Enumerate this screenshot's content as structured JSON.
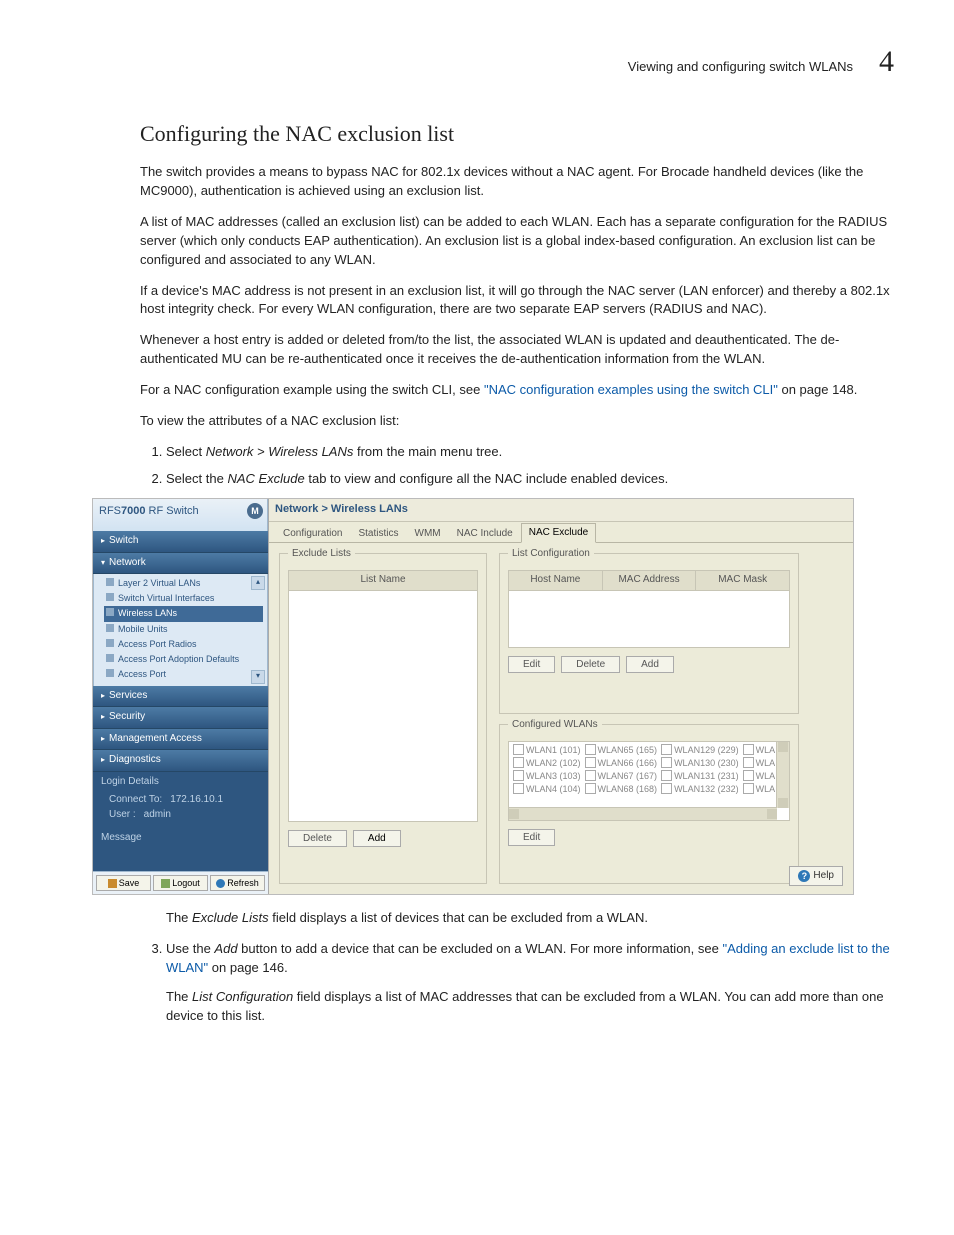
{
  "header": {
    "section_name": "Viewing and configuring switch WLANs",
    "chapter_number": "4"
  },
  "title": "Configuring the NAC exclusion list",
  "para1": "The switch provides a means to bypass NAC for 802.1x devices without a NAC agent. For Brocade handheld devices (like the MC9000), authentication is achieved using an exclusion list.",
  "para2": "A list of MAC addresses (called an exclusion list) can be added to each WLAN. Each has a separate configuration for the RADIUS server (which only conducts EAP authentication). An exclusion list is a global index-based configuration. An exclusion list can be configured and associated to any WLAN.",
  "para3": "If a device's MAC address is not present in an exclusion list, it will go through the NAC server (LAN enforcer) and thereby a 802.1x host integrity check. For every WLAN configuration, there are two separate EAP servers (RADIUS and NAC).",
  "para4": "Whenever a host entry is added or deleted from/to the list, the associated WLAN is updated and deauthenticated. The de-authenticated MU can be re-authenticated once it receives the de-authentication information from the WLAN.",
  "para5_pre": "For a NAC configuration example using the switch CLI, see ",
  "para5_link": "\"NAC configuration examples using the switch CLI\"",
  "para5_post": " on page 148.",
  "para6": "To view the attributes of a NAC exclusion list:",
  "step1_pre": "Select ",
  "step1_em": "Network > Wireless LANs",
  "step1_post": " from the main menu tree.",
  "step2_pre": "Select the ",
  "step2_em": "NAC Exclude",
  "step2_post": " tab to view and configure all the NAC include enabled devices.",
  "excl_para_pre": "The ",
  "excl_para_em": "Exclude Lists",
  "excl_para_post": " field displays a list of devices that can be excluded from a WLAN.",
  "step3_pre": "Use the ",
  "step3_em": "Add",
  "step3_mid": " button to add a device that can be excluded on a WLAN. For more information, see ",
  "step3_link": "\"Adding an exclude list to the WLAN\"",
  "step3_post": " on page 146.",
  "listcfg_pre": "The ",
  "listcfg_em": "List Configuration",
  "listcfg_post": " field displays a list of MAC addresses that can be excluded from a WLAN. You can add more than one device to this list.",
  "app": {
    "product_prefix": "RFS",
    "product_bold": "7000",
    "product_suffix": " RF Switch",
    "nav": {
      "switch": "Switch",
      "network": "Network",
      "tree": {
        "l2vlan": "Layer 2 Virtual LANs",
        "svi": "Switch Virtual Interfaces",
        "wlan": "Wireless LANs",
        "mu": "Mobile Units",
        "apr": "Access Port Radios",
        "apad": "Access Port Adoption Defaults",
        "ap": "Access Port"
      },
      "services": "Services",
      "security": "Security",
      "mgmt": "Management Access",
      "diag": "Diagnostics"
    },
    "login": {
      "legend": "Login Details",
      "connect_lbl": "Connect To:",
      "connect_val": "172.16.10.1",
      "user_lbl": "User :",
      "user_val": "admin"
    },
    "message": "Message",
    "buttons": {
      "save": "Save",
      "logout": "Logout",
      "refresh": "Refresh"
    },
    "crumb": "Network > Wireless LANs",
    "tabs": {
      "config": "Configuration",
      "stats": "Statistics",
      "wmm": "WMM",
      "naci": "NAC Include",
      "nace": "NAC Exclude"
    },
    "exclude_lists": {
      "legend": "Exclude Lists",
      "col_listname": "List Name",
      "btn_delete": "Delete",
      "btn_add": "Add"
    },
    "list_config": {
      "legend": "List Configuration",
      "col_host": "Host Name",
      "col_mac": "MAC Address",
      "col_mask": "MAC Mask",
      "btn_edit": "Edit",
      "btn_delete": "Delete",
      "btn_add": "Add"
    },
    "configured_wlans": {
      "legend": "Configured WLANs",
      "rows": [
        [
          "WLAN1 (101)",
          "WLAN65 (165)",
          "WLAN129 (229)",
          "WLA"
        ],
        [
          "WLAN2 (102)",
          "WLAN66 (166)",
          "WLAN130 (230)",
          "WLA"
        ],
        [
          "WLAN3 (103)",
          "WLAN67 (167)",
          "WLAN131 (231)",
          "WLA"
        ],
        [
          "WLAN4 (104)",
          "WLAN68 (168)",
          "WLAN132 (232)",
          "WLA"
        ]
      ],
      "btn_edit": "Edit"
    },
    "help": "Help"
  }
}
